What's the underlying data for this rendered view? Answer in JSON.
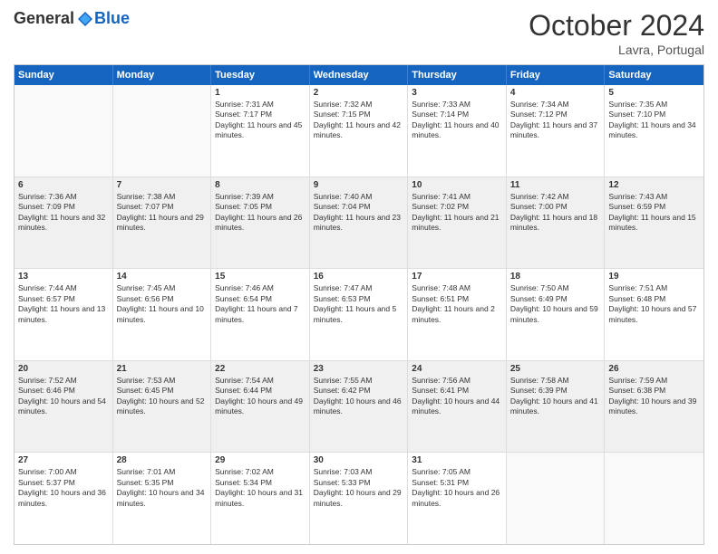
{
  "logo": {
    "general": "General",
    "blue": "Blue"
  },
  "title": "October 2024",
  "subtitle": "Lavra, Portugal",
  "days": [
    "Sunday",
    "Monday",
    "Tuesday",
    "Wednesday",
    "Thursday",
    "Friday",
    "Saturday"
  ],
  "rows": [
    [
      {
        "day": "",
        "sunrise": "",
        "sunset": "",
        "daylight": "",
        "empty": true
      },
      {
        "day": "",
        "sunrise": "",
        "sunset": "",
        "daylight": "",
        "empty": true
      },
      {
        "day": "1",
        "sunrise": "Sunrise: 7:31 AM",
        "sunset": "Sunset: 7:17 PM",
        "daylight": "Daylight: 11 hours and 45 minutes.",
        "empty": false
      },
      {
        "day": "2",
        "sunrise": "Sunrise: 7:32 AM",
        "sunset": "Sunset: 7:15 PM",
        "daylight": "Daylight: 11 hours and 42 minutes.",
        "empty": false
      },
      {
        "day": "3",
        "sunrise": "Sunrise: 7:33 AM",
        "sunset": "Sunset: 7:14 PM",
        "daylight": "Daylight: 11 hours and 40 minutes.",
        "empty": false
      },
      {
        "day": "4",
        "sunrise": "Sunrise: 7:34 AM",
        "sunset": "Sunset: 7:12 PM",
        "daylight": "Daylight: 11 hours and 37 minutes.",
        "empty": false
      },
      {
        "day": "5",
        "sunrise": "Sunrise: 7:35 AM",
        "sunset": "Sunset: 7:10 PM",
        "daylight": "Daylight: 11 hours and 34 minutes.",
        "empty": false
      }
    ],
    [
      {
        "day": "6",
        "sunrise": "Sunrise: 7:36 AM",
        "sunset": "Sunset: 7:09 PM",
        "daylight": "Daylight: 11 hours and 32 minutes.",
        "empty": false
      },
      {
        "day": "7",
        "sunrise": "Sunrise: 7:38 AM",
        "sunset": "Sunset: 7:07 PM",
        "daylight": "Daylight: 11 hours and 29 minutes.",
        "empty": false
      },
      {
        "day": "8",
        "sunrise": "Sunrise: 7:39 AM",
        "sunset": "Sunset: 7:05 PM",
        "daylight": "Daylight: 11 hours and 26 minutes.",
        "empty": false
      },
      {
        "day": "9",
        "sunrise": "Sunrise: 7:40 AM",
        "sunset": "Sunset: 7:04 PM",
        "daylight": "Daylight: 11 hours and 23 minutes.",
        "empty": false
      },
      {
        "day": "10",
        "sunrise": "Sunrise: 7:41 AM",
        "sunset": "Sunset: 7:02 PM",
        "daylight": "Daylight: 11 hours and 21 minutes.",
        "empty": false
      },
      {
        "day": "11",
        "sunrise": "Sunrise: 7:42 AM",
        "sunset": "Sunset: 7:00 PM",
        "daylight": "Daylight: 11 hours and 18 minutes.",
        "empty": false
      },
      {
        "day": "12",
        "sunrise": "Sunrise: 7:43 AM",
        "sunset": "Sunset: 6:59 PM",
        "daylight": "Daylight: 11 hours and 15 minutes.",
        "empty": false
      }
    ],
    [
      {
        "day": "13",
        "sunrise": "Sunrise: 7:44 AM",
        "sunset": "Sunset: 6:57 PM",
        "daylight": "Daylight: 11 hours and 13 minutes.",
        "empty": false
      },
      {
        "day": "14",
        "sunrise": "Sunrise: 7:45 AM",
        "sunset": "Sunset: 6:56 PM",
        "daylight": "Daylight: 11 hours and 10 minutes.",
        "empty": false
      },
      {
        "day": "15",
        "sunrise": "Sunrise: 7:46 AM",
        "sunset": "Sunset: 6:54 PM",
        "daylight": "Daylight: 11 hours and 7 minutes.",
        "empty": false
      },
      {
        "day": "16",
        "sunrise": "Sunrise: 7:47 AM",
        "sunset": "Sunset: 6:53 PM",
        "daylight": "Daylight: 11 hours and 5 minutes.",
        "empty": false
      },
      {
        "day": "17",
        "sunrise": "Sunrise: 7:48 AM",
        "sunset": "Sunset: 6:51 PM",
        "daylight": "Daylight: 11 hours and 2 minutes.",
        "empty": false
      },
      {
        "day": "18",
        "sunrise": "Sunrise: 7:50 AM",
        "sunset": "Sunset: 6:49 PM",
        "daylight": "Daylight: 10 hours and 59 minutes.",
        "empty": false
      },
      {
        "day": "19",
        "sunrise": "Sunrise: 7:51 AM",
        "sunset": "Sunset: 6:48 PM",
        "daylight": "Daylight: 10 hours and 57 minutes.",
        "empty": false
      }
    ],
    [
      {
        "day": "20",
        "sunrise": "Sunrise: 7:52 AM",
        "sunset": "Sunset: 6:46 PM",
        "daylight": "Daylight: 10 hours and 54 minutes.",
        "empty": false
      },
      {
        "day": "21",
        "sunrise": "Sunrise: 7:53 AM",
        "sunset": "Sunset: 6:45 PM",
        "daylight": "Daylight: 10 hours and 52 minutes.",
        "empty": false
      },
      {
        "day": "22",
        "sunrise": "Sunrise: 7:54 AM",
        "sunset": "Sunset: 6:44 PM",
        "daylight": "Daylight: 10 hours and 49 minutes.",
        "empty": false
      },
      {
        "day": "23",
        "sunrise": "Sunrise: 7:55 AM",
        "sunset": "Sunset: 6:42 PM",
        "daylight": "Daylight: 10 hours and 46 minutes.",
        "empty": false
      },
      {
        "day": "24",
        "sunrise": "Sunrise: 7:56 AM",
        "sunset": "Sunset: 6:41 PM",
        "daylight": "Daylight: 10 hours and 44 minutes.",
        "empty": false
      },
      {
        "day": "25",
        "sunrise": "Sunrise: 7:58 AM",
        "sunset": "Sunset: 6:39 PM",
        "daylight": "Daylight: 10 hours and 41 minutes.",
        "empty": false
      },
      {
        "day": "26",
        "sunrise": "Sunrise: 7:59 AM",
        "sunset": "Sunset: 6:38 PM",
        "daylight": "Daylight: 10 hours and 39 minutes.",
        "empty": false
      }
    ],
    [
      {
        "day": "27",
        "sunrise": "Sunrise: 7:00 AM",
        "sunset": "Sunset: 5:37 PM",
        "daylight": "Daylight: 10 hours and 36 minutes.",
        "empty": false
      },
      {
        "day": "28",
        "sunrise": "Sunrise: 7:01 AM",
        "sunset": "Sunset: 5:35 PM",
        "daylight": "Daylight: 10 hours and 34 minutes.",
        "empty": false
      },
      {
        "day": "29",
        "sunrise": "Sunrise: 7:02 AM",
        "sunset": "Sunset: 5:34 PM",
        "daylight": "Daylight: 10 hours and 31 minutes.",
        "empty": false
      },
      {
        "day": "30",
        "sunrise": "Sunrise: 7:03 AM",
        "sunset": "Sunset: 5:33 PM",
        "daylight": "Daylight: 10 hours and 29 minutes.",
        "empty": false
      },
      {
        "day": "31",
        "sunrise": "Sunrise: 7:05 AM",
        "sunset": "Sunset: 5:31 PM",
        "daylight": "Daylight: 10 hours and 26 minutes.",
        "empty": false
      },
      {
        "day": "",
        "sunrise": "",
        "sunset": "",
        "daylight": "",
        "empty": true
      },
      {
        "day": "",
        "sunrise": "",
        "sunset": "",
        "daylight": "",
        "empty": true
      }
    ]
  ]
}
